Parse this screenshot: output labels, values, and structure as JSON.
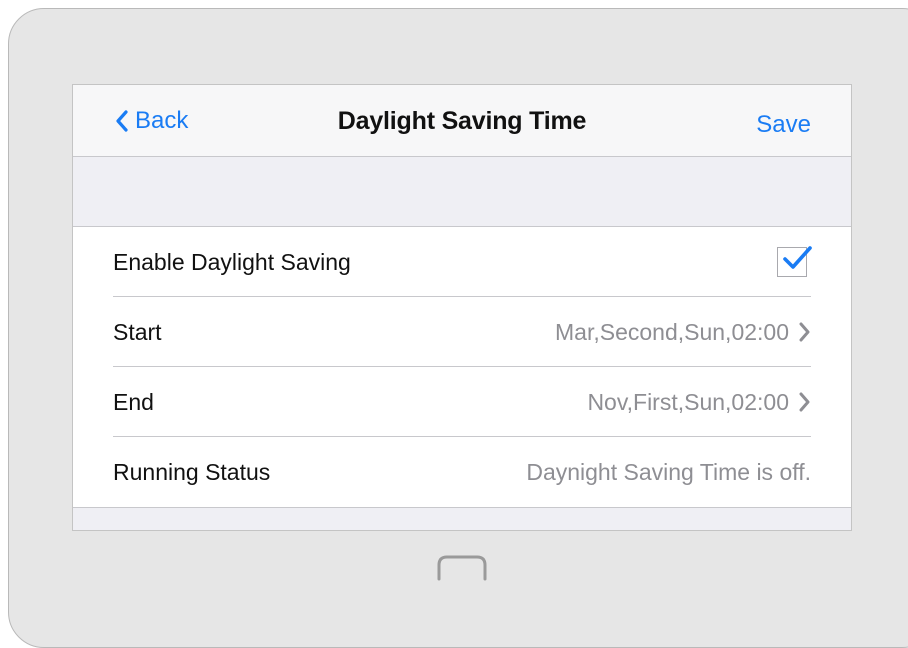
{
  "navbar": {
    "back_label": "Back",
    "title": "Daylight Saving Time",
    "save_label": "Save"
  },
  "settings": {
    "enable_label": "Enable Daylight Saving",
    "enable_checked": true,
    "start_label": "Start",
    "start_value": "Mar,Second,Sun,02:00",
    "end_label": "End",
    "end_value": "Nov,First,Sun,02:00",
    "status_label": "Running Status",
    "status_value": "Daynight Saving Time is off."
  },
  "colors": {
    "accent": "#1a7cf4",
    "secondary_text": "#8e8e93",
    "frame": "#e6e6e6",
    "section_background": "#efeff4"
  },
  "icons": {
    "back": "chevron-left-icon",
    "check": "checkmark-icon",
    "disclosure": "chevron-right-icon",
    "home": "home-button-icon"
  }
}
